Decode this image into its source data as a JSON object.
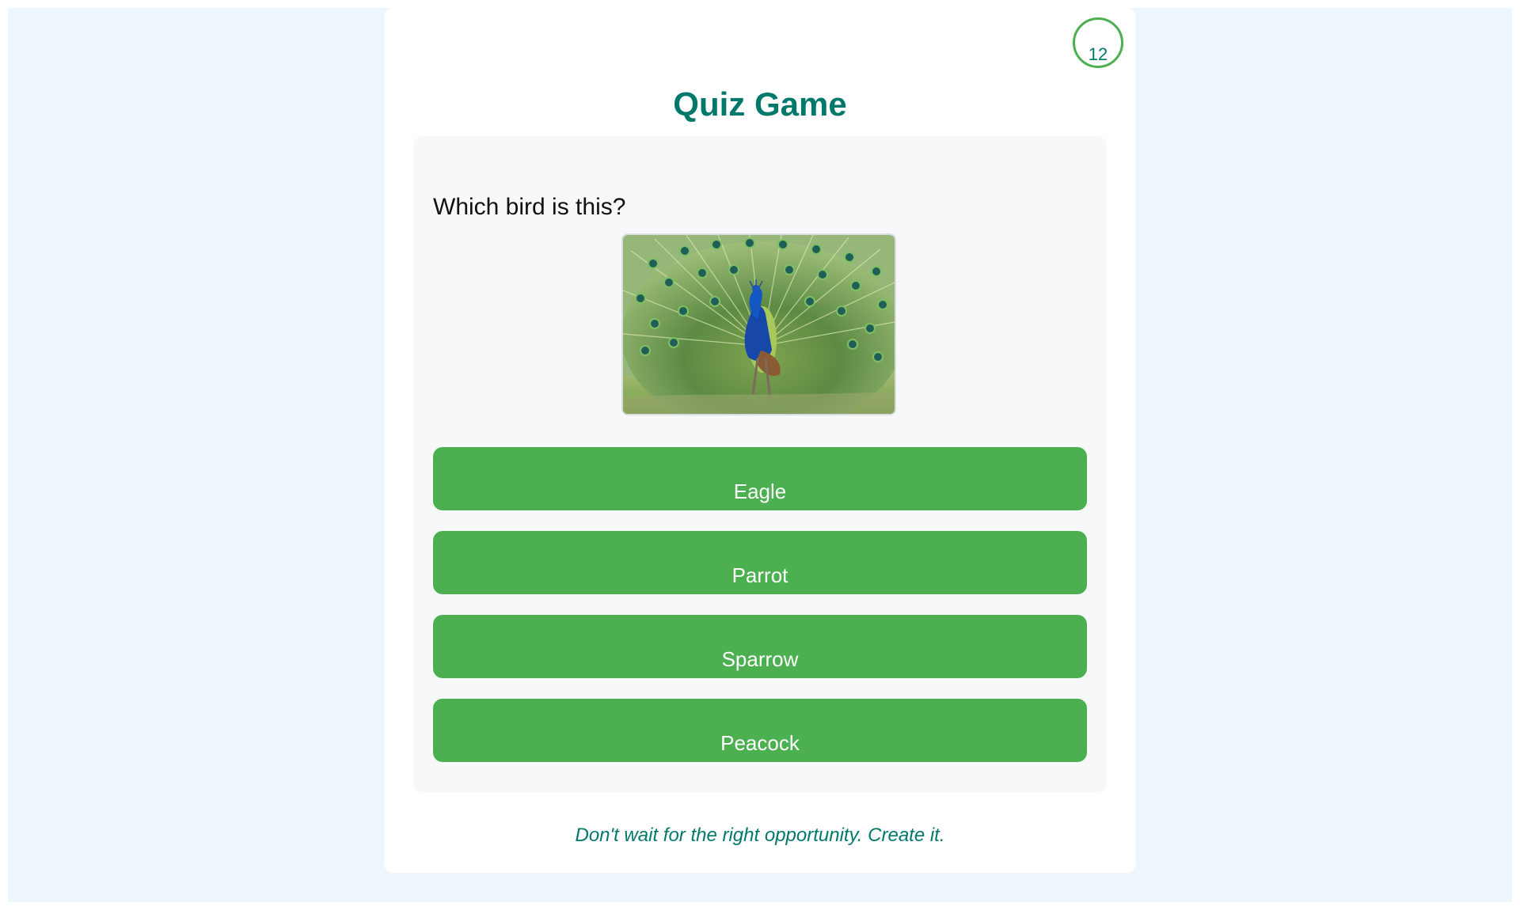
{
  "app": {
    "title": "Quiz Game"
  },
  "timer": {
    "value": "12"
  },
  "question": {
    "text": "Which bird is this?",
    "image_icon": "peacock-image"
  },
  "answers": [
    {
      "label": "Eagle"
    },
    {
      "label": "Parrot"
    },
    {
      "label": "Sparrow"
    },
    {
      "label": "Peacock"
    }
  ],
  "footer": {
    "quote": "Don't wait for the right opportunity. Create it."
  },
  "colors": {
    "accent": "#00796b",
    "button": "#4caf50",
    "background": "#eef6fd",
    "panel": "#f6f8fa"
  }
}
